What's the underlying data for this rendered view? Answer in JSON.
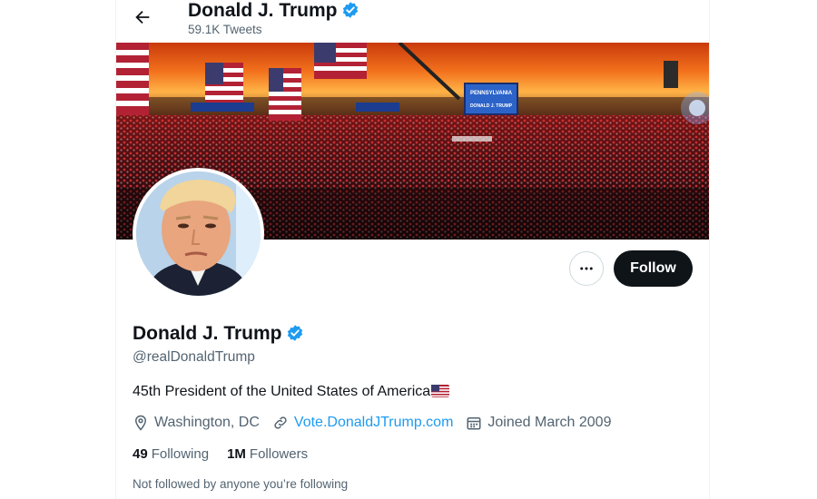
{
  "header": {
    "title": "Donald J. Trump",
    "tweet_count": "59.1K Tweets"
  },
  "banner": {
    "screen_line1": "PENNSYLVANIA",
    "screen_line2": "DONALD J. TRUMP"
  },
  "profile": {
    "name": "Donald J. Trump",
    "handle": "@realDonaldTrump",
    "bio": "45th President of the United States of America",
    "location": "Washington, DC",
    "website": "Vote.DonaldJTrump.com",
    "joined": "Joined March 2009",
    "following_count": "49",
    "following_label": "Following",
    "followers_count": "1M",
    "followers_label": "Followers",
    "followed_by_note": "Not followed by anyone you’re following"
  },
  "actions": {
    "follow_label": "Follow",
    "more_icon": "ellipsis-icon"
  },
  "colors": {
    "accent": "#1d9bf0",
    "text": "#0f1419",
    "muted": "#536471",
    "follow_bg": "#0f1419"
  }
}
